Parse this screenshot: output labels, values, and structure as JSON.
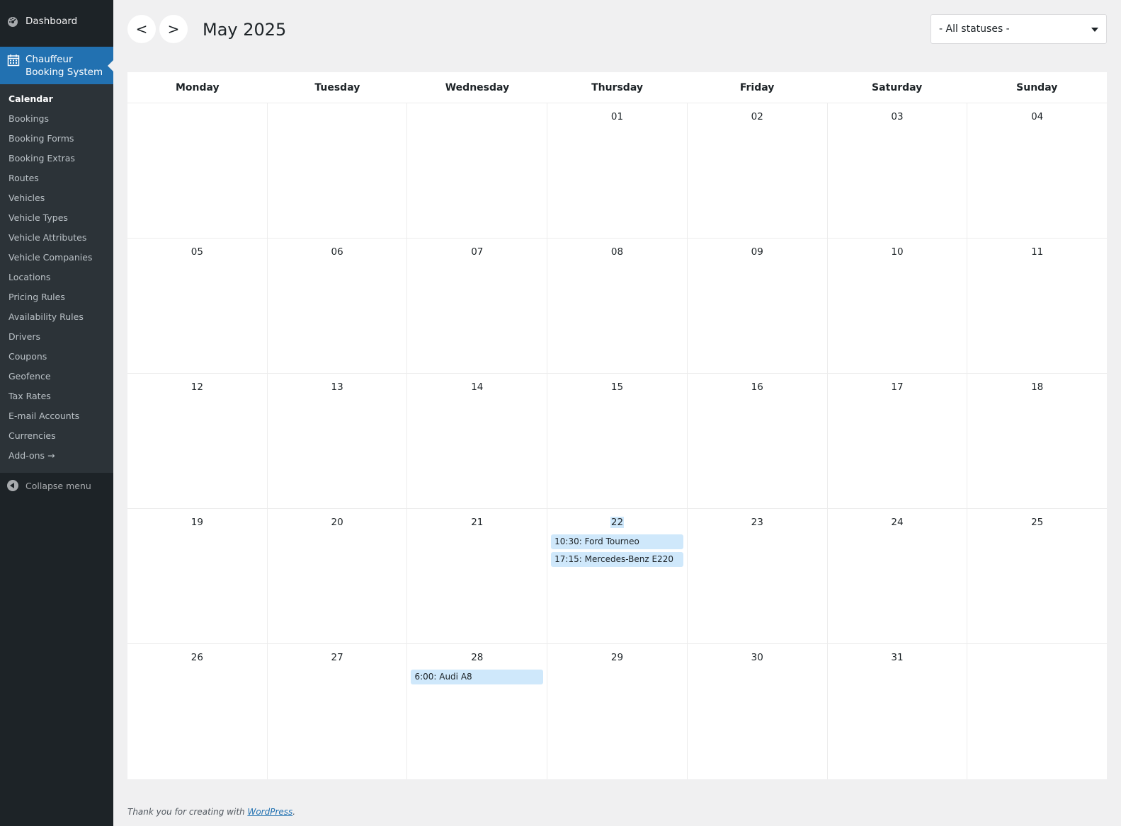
{
  "sidebar": {
    "dashboard": "Dashboard",
    "active_menu": [
      "Chauffeur",
      "Booking System"
    ],
    "items": [
      {
        "label": "Calendar",
        "current": true
      },
      {
        "label": "Bookings"
      },
      {
        "label": "Booking Forms"
      },
      {
        "label": "Booking Extras"
      },
      {
        "label": "Routes"
      },
      {
        "label": "Vehicles"
      },
      {
        "label": "Vehicle Types"
      },
      {
        "label": "Vehicle Attributes"
      },
      {
        "label": "Vehicle Companies"
      },
      {
        "label": "Locations"
      },
      {
        "label": "Pricing Rules"
      },
      {
        "label": "Availability Rules"
      },
      {
        "label": "Drivers"
      },
      {
        "label": "Coupons"
      },
      {
        "label": "Geofence"
      },
      {
        "label": "Tax Rates"
      },
      {
        "label": "E-mail Accounts"
      },
      {
        "label": "Currencies"
      },
      {
        "label": "Add-ons →"
      }
    ],
    "collapse": "Collapse menu"
  },
  "toolbar": {
    "prev": "<",
    "next": ">",
    "month": "May 2025",
    "status_filter": "- All statuses -"
  },
  "calendar": {
    "day_names": [
      "Monday",
      "Tuesday",
      "Wednesday",
      "Thursday",
      "Friday",
      "Saturday",
      "Sunday"
    ],
    "weeks": [
      [
        {
          "d": ""
        },
        {
          "d": ""
        },
        {
          "d": ""
        },
        {
          "d": "01"
        },
        {
          "d": "02"
        },
        {
          "d": "03"
        },
        {
          "d": "04"
        }
      ],
      [
        {
          "d": "05"
        },
        {
          "d": "06"
        },
        {
          "d": "07"
        },
        {
          "d": "08"
        },
        {
          "d": "09"
        },
        {
          "d": "10"
        },
        {
          "d": "11"
        }
      ],
      [
        {
          "d": "12"
        },
        {
          "d": "13"
        },
        {
          "d": "14"
        },
        {
          "d": "15"
        },
        {
          "d": "16"
        },
        {
          "d": "17"
        },
        {
          "d": "18"
        }
      ],
      [
        {
          "d": "19"
        },
        {
          "d": "20"
        },
        {
          "d": "21"
        },
        {
          "d": "22",
          "today": true,
          "events": [
            "10:30: Ford Tourneo",
            "17:15: Mercedes-Benz E220"
          ]
        },
        {
          "d": "23"
        },
        {
          "d": "24"
        },
        {
          "d": "25"
        }
      ],
      [
        {
          "d": "26"
        },
        {
          "d": "27"
        },
        {
          "d": "28",
          "events": [
            "6:00: Audi A8"
          ]
        },
        {
          "d": "29"
        },
        {
          "d": "30"
        },
        {
          "d": "31"
        },
        {
          "d": ""
        }
      ]
    ]
  },
  "footer": {
    "prefix": "Thank you for creating with ",
    "link": "WordPress",
    "suffix": "."
  }
}
